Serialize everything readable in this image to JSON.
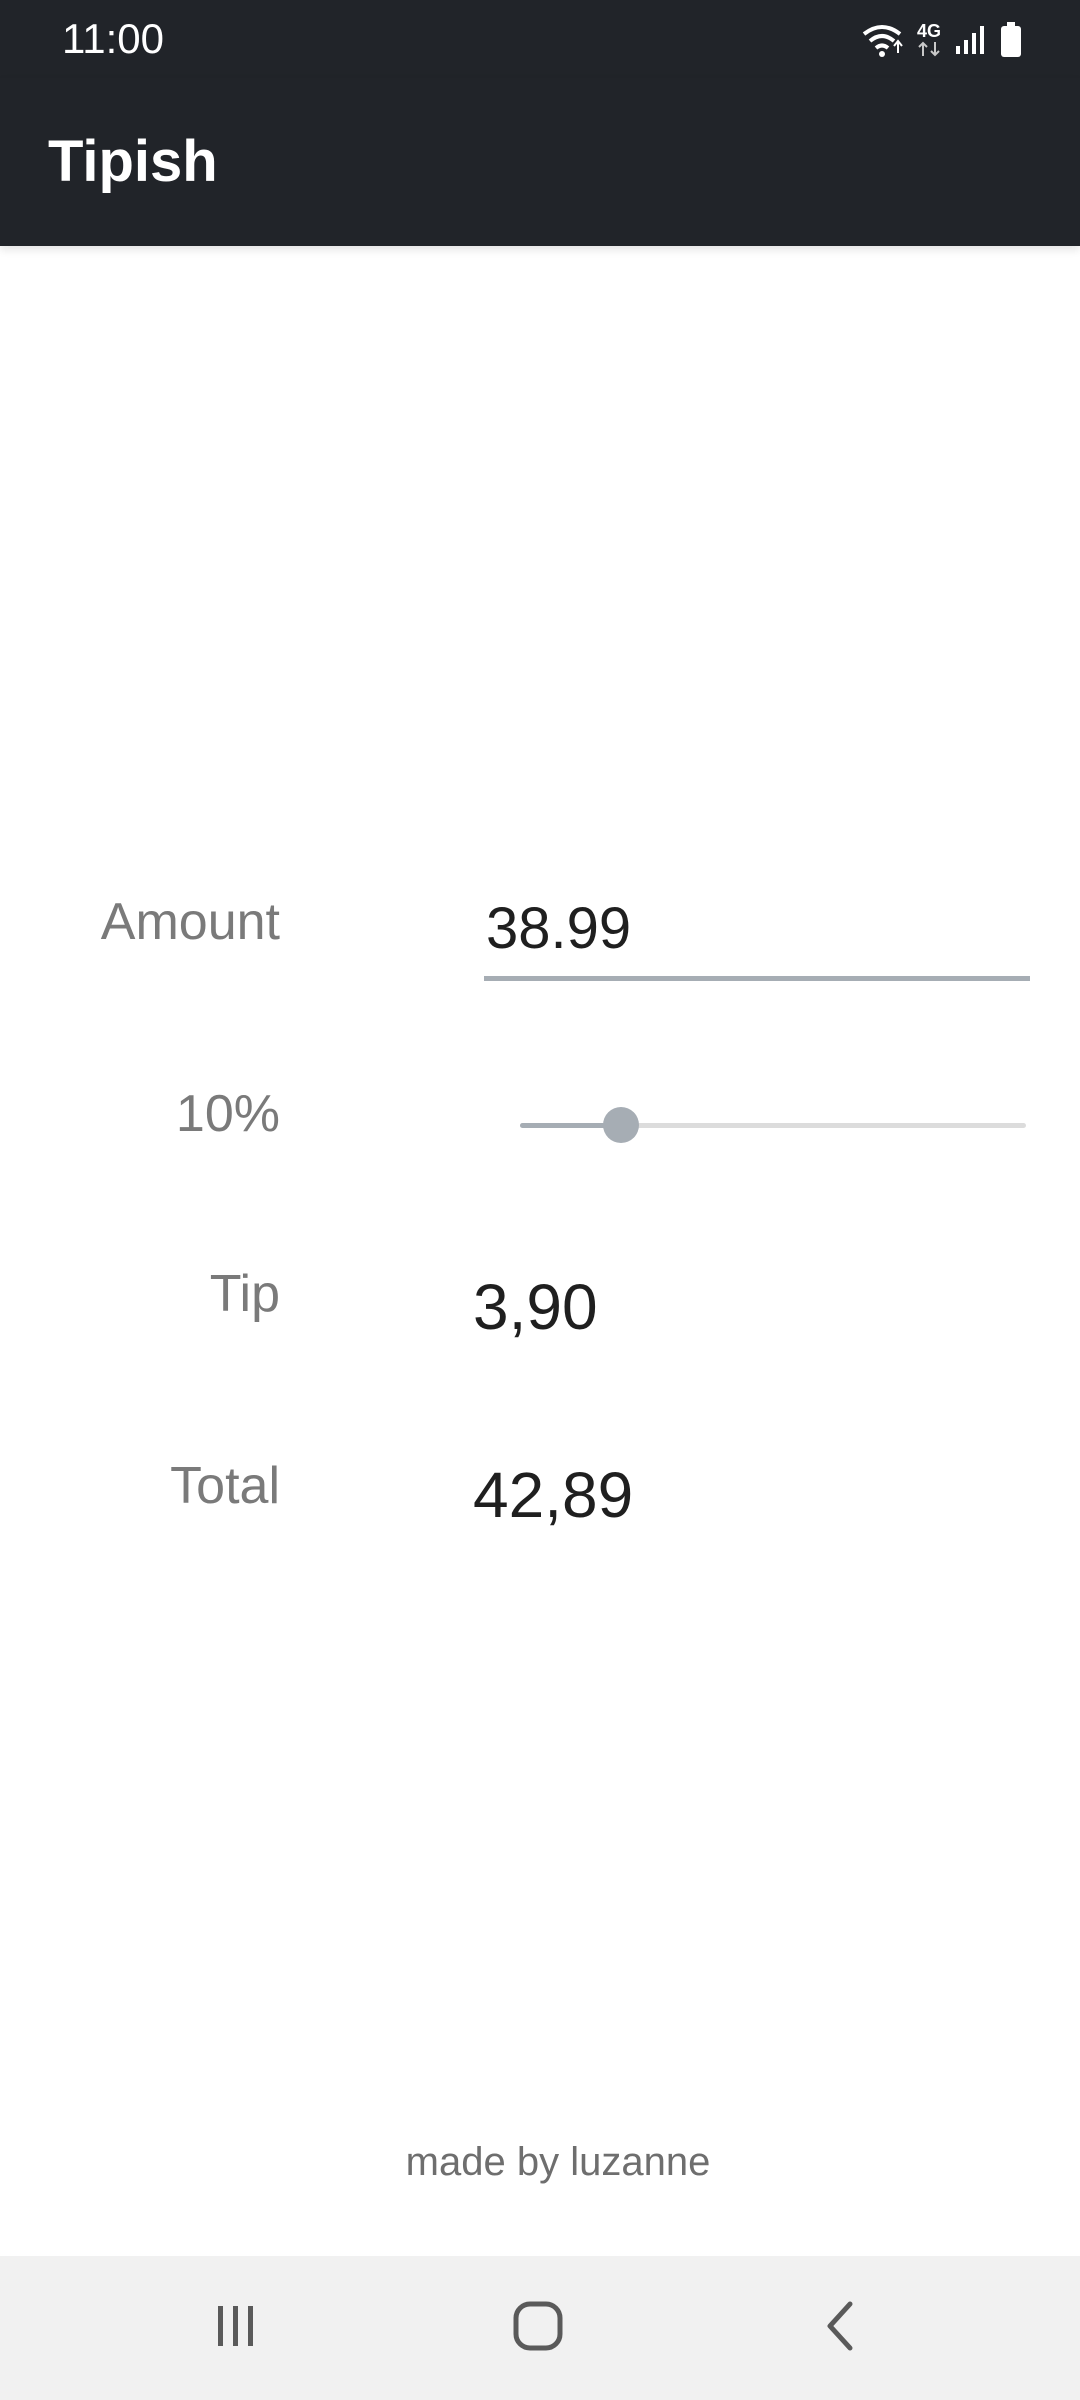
{
  "status_bar": {
    "time": "11:00",
    "icons": [
      "wifi-icon",
      "4g-data-icon",
      "signal-icon",
      "battery-icon"
    ],
    "network_label": "4G"
  },
  "app_bar": {
    "title": "Tipish",
    "background": "#212429"
  },
  "form": {
    "amount_label": "Amount",
    "amount_value": "38.99",
    "percent_label": "10%",
    "tip_percent_fraction": 0.2,
    "tip_label": "Tip",
    "tip_value": "3,90",
    "total_label": "Total",
    "total_value": "42,89"
  },
  "footer": {
    "credit": "made by luzanne"
  },
  "nav_bar": {
    "buttons": [
      "recents-icon",
      "home-icon",
      "back-icon"
    ]
  },
  "colors": {
    "accent": "#a6adb4",
    "label_text": "#7a7a7a",
    "value_text": "#1f1f1f"
  }
}
